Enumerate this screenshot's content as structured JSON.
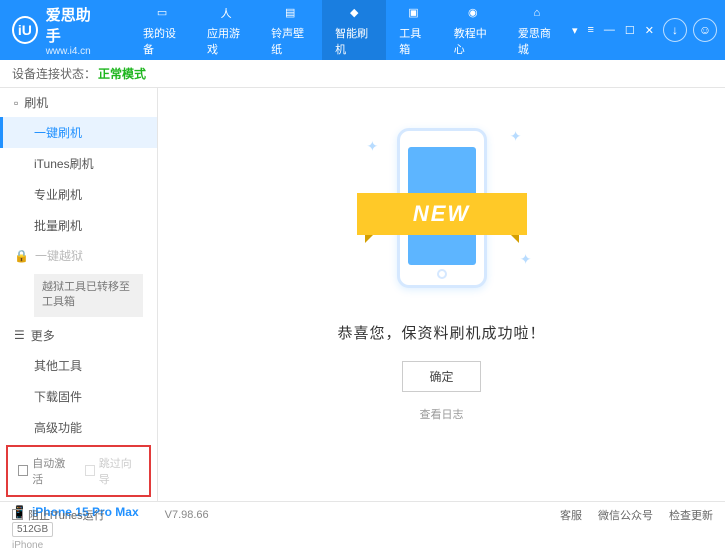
{
  "header": {
    "logo_char": "iU",
    "title": "爱思助手",
    "url": "www.i4.cn",
    "nav": [
      {
        "label": "我的设备"
      },
      {
        "label": "应用游戏"
      },
      {
        "label": "铃声壁纸"
      },
      {
        "label": "智能刷机"
      },
      {
        "label": "工具箱"
      },
      {
        "label": "教程中心"
      },
      {
        "label": "爱思商城"
      }
    ]
  },
  "status": {
    "label": "设备连接状态：",
    "value": "正常模式"
  },
  "sidebar": {
    "flash_header": "刷机",
    "flash_items": [
      "一键刷机",
      "iTunes刷机",
      "专业刷机",
      "批量刷机"
    ],
    "jailbreak_header": "一键越狱",
    "jailbreak_note": "越狱工具已转移至工具箱",
    "more_header": "更多",
    "more_items": [
      "其他工具",
      "下载固件",
      "高级功能"
    ],
    "checks": {
      "auto_activate": "自动激活",
      "skip_guide": "跳过向导"
    }
  },
  "device": {
    "name": "iPhone 15 Pro Max",
    "storage": "512GB",
    "type": "iPhone"
  },
  "main": {
    "new_text": "NEW",
    "success": "恭喜您，保资料刷机成功啦！",
    "confirm": "确定",
    "view_log": "查看日志"
  },
  "footer": {
    "block_itunes": "阻止iTunes运行",
    "version": "V7.98.66",
    "links": [
      "客服",
      "微信公众号",
      "检查更新"
    ]
  }
}
